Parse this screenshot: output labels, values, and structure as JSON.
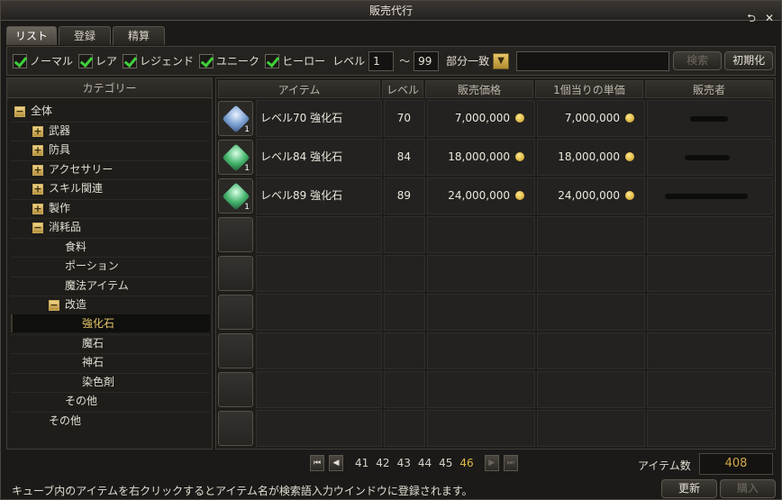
{
  "window": {
    "title": "販売代行"
  },
  "titlebar_icons": [
    "restore-icon",
    "close-icon"
  ],
  "tabs": [
    {
      "label": "リスト",
      "active": true
    },
    {
      "label": "登録",
      "active": false
    },
    {
      "label": "精算",
      "active": false
    }
  ],
  "filters": {
    "grades": [
      {
        "label": "ノーマル",
        "checked": true
      },
      {
        "label": "レア",
        "checked": true
      },
      {
        "label": "レジェンド",
        "checked": true
      },
      {
        "label": "ユニーク",
        "checked": true
      },
      {
        "label": "ヒーロー",
        "checked": true
      }
    ],
    "level_label": "レベル",
    "level_min": "1",
    "level_sep": "～",
    "level_max": "99",
    "match_mode": "部分一致",
    "search_value": "",
    "search_button": "検索",
    "reset_button": "初期化"
  },
  "category": {
    "header": "カテゴリー",
    "items": [
      {
        "label": "全体",
        "toggle": "−"
      },
      {
        "label": "武器",
        "toggle": "+"
      },
      {
        "label": "防具",
        "toggle": "+"
      },
      {
        "label": "アクセサリー",
        "toggle": "+"
      },
      {
        "label": "スキル関連",
        "toggle": "+"
      },
      {
        "label": "製作",
        "toggle": "+"
      },
      {
        "label": "消耗品",
        "toggle": "−"
      },
      {
        "label": "食料",
        "toggle": ""
      },
      {
        "label": "ポーション",
        "toggle": ""
      },
      {
        "label": "魔法アイテム",
        "toggle": ""
      },
      {
        "label": "改造",
        "toggle": "−"
      },
      {
        "label": "強化石",
        "toggle": "",
        "selected": true
      },
      {
        "label": "魔石",
        "toggle": ""
      },
      {
        "label": "神石",
        "toggle": ""
      },
      {
        "label": "染色剤",
        "toggle": ""
      },
      {
        "label": "その他",
        "toggle": ""
      },
      {
        "label": "その他",
        "toggle": ""
      }
    ]
  },
  "grid": {
    "headers": [
      "アイテム",
      "レベル",
      "販売価格",
      "1個当りの単価",
      "販売者"
    ],
    "rows": [
      {
        "name": "レベル70  強化石",
        "level": "70",
        "price": "7,000,000",
        "unit_price": "7,000,000",
        "qty": "1",
        "gem": "blue"
      },
      {
        "name": "レベル84  強化石",
        "level": "84",
        "price": "18,000,000",
        "unit_price": "18,000,000",
        "qty": "1",
        "gem": "green"
      },
      {
        "name": "レベル89  強化石",
        "level": "89",
        "price": "24,000,000",
        "unit_price": "24,000,000",
        "qty": "1",
        "gem": "green"
      }
    ],
    "empty_rows": 6
  },
  "pager": {
    "pages": [
      "41",
      "42",
      "43",
      "44",
      "45",
      "46"
    ],
    "current": "46"
  },
  "item_count_label": "アイテム数",
  "item_count": "408",
  "status_text": "キューブ内のアイテムを右クリックするとアイテム名が検索語入力ウインドウに登録されます。",
  "refresh_button": "更新",
  "buy_button": "購入"
}
